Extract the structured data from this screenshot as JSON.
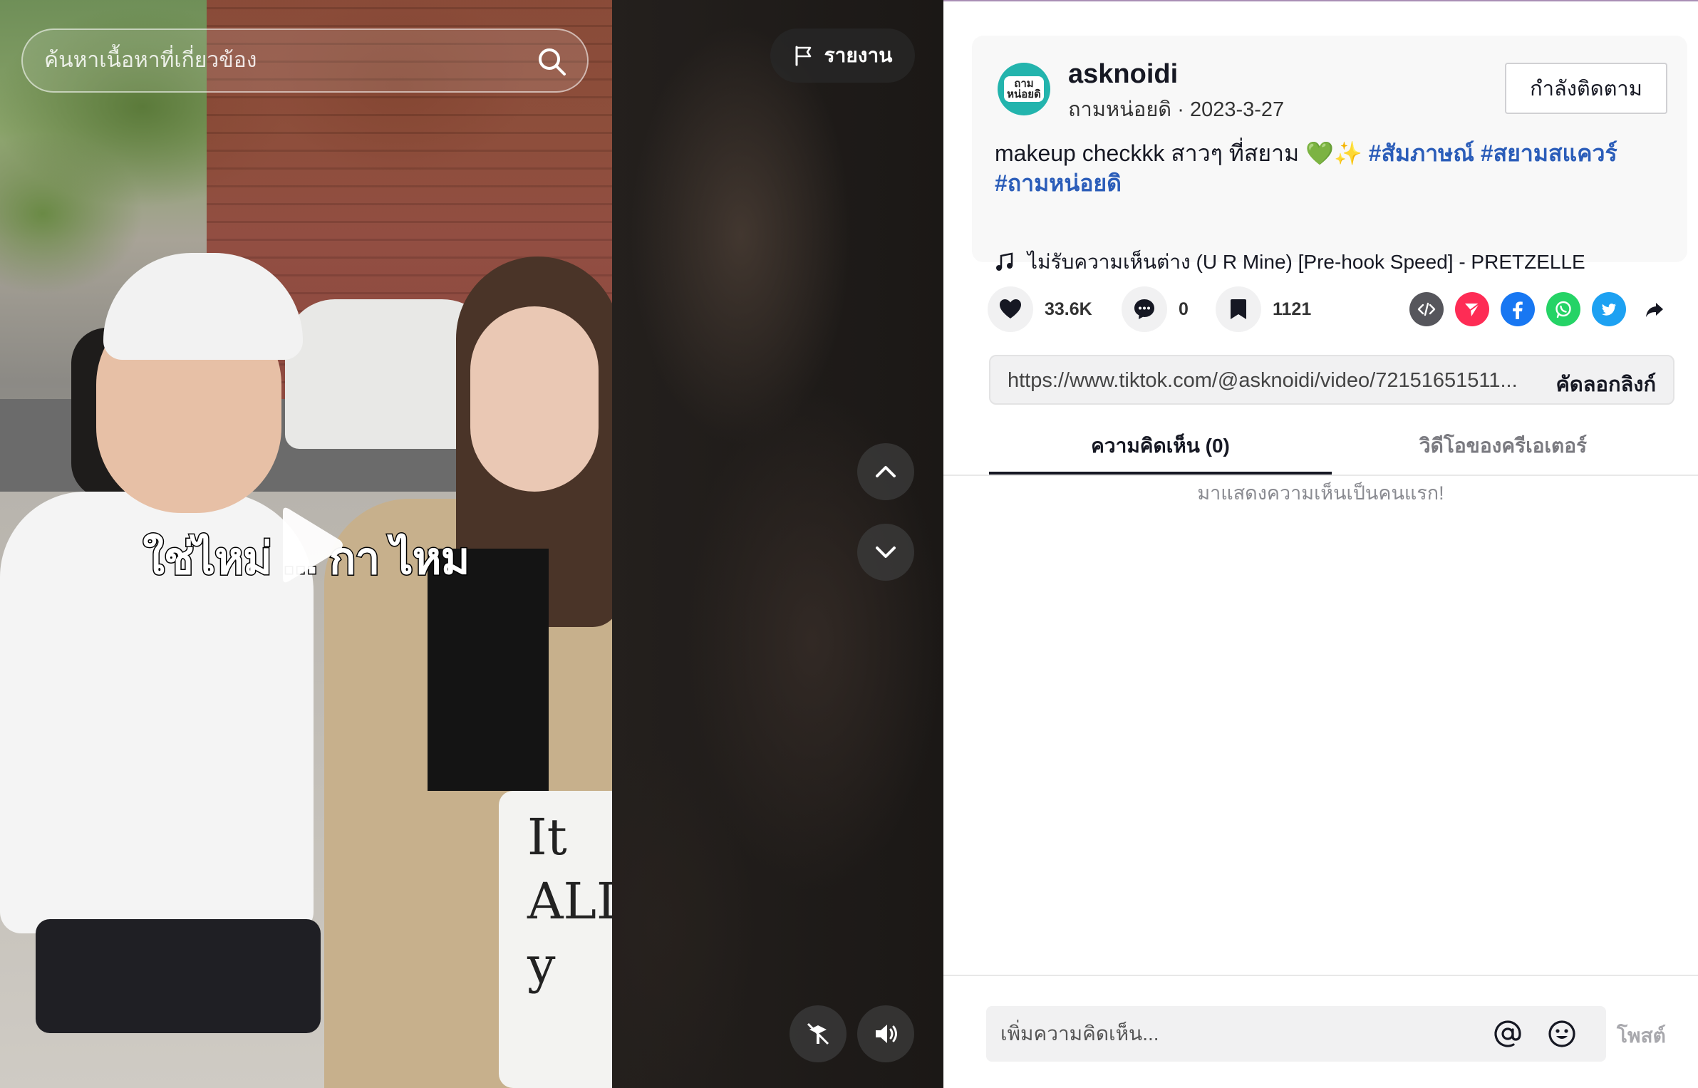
{
  "search": {
    "placeholder": "ค้นหาเนื้อหาที่เกี่ยวข้อง"
  },
  "video": {
    "report_label": "รายงาน",
    "subtitle": "ใช่ไหม่ ... กา ไหม",
    "tote_text": "It ALL y"
  },
  "post": {
    "avatar_text": "ถามหน่อยดิ",
    "username": "asknoidi",
    "nickname": "ถามหน่อยดิ",
    "separator": " · ",
    "date": "2023-3-27",
    "follow_label": "กำลังติดตาม",
    "caption_text": "makeup checkkk สาวๆ ที่สยาม ",
    "caption_emoji_heart": "💚",
    "caption_emoji_sparkle": "✨",
    "hashtags": [
      "#สัมภาษณ์",
      "#สยามสแควร์",
      "#ถามหน่อยดิ"
    ],
    "music": "ไม่รับความเห็นต่าง (U R Mine) [Pre-hook Speed] - PRETZELLE"
  },
  "actions": {
    "likes": "33.6K",
    "comments": "0",
    "saves": "1121"
  },
  "share": {
    "icons": [
      "embed-icon",
      "send-icon",
      "facebook-icon",
      "whatsapp-icon",
      "twitter-icon",
      "share-arrow-icon"
    ],
    "colors": {
      "send": "#fe2c55",
      "facebook": "#1877f2",
      "whatsapp": "#25d366",
      "twitter": "#1da1f2",
      "embed": "#56565c"
    }
  },
  "link": {
    "url": "https://www.tiktok.com/@asknoidi/video/72151651511...",
    "copy_label": "คัดลอกลิงก์"
  },
  "tabs": {
    "comments_label": "ความคิดเห็น (0)",
    "creator_videos_label": "วิดีโอของครีเอเตอร์"
  },
  "comments": {
    "empty_text": "มาแสดงความเห็นเป็นคนแรก!",
    "input_placeholder": "เพิ่มความคิดเห็น...",
    "post_label": "โพสต์"
  }
}
